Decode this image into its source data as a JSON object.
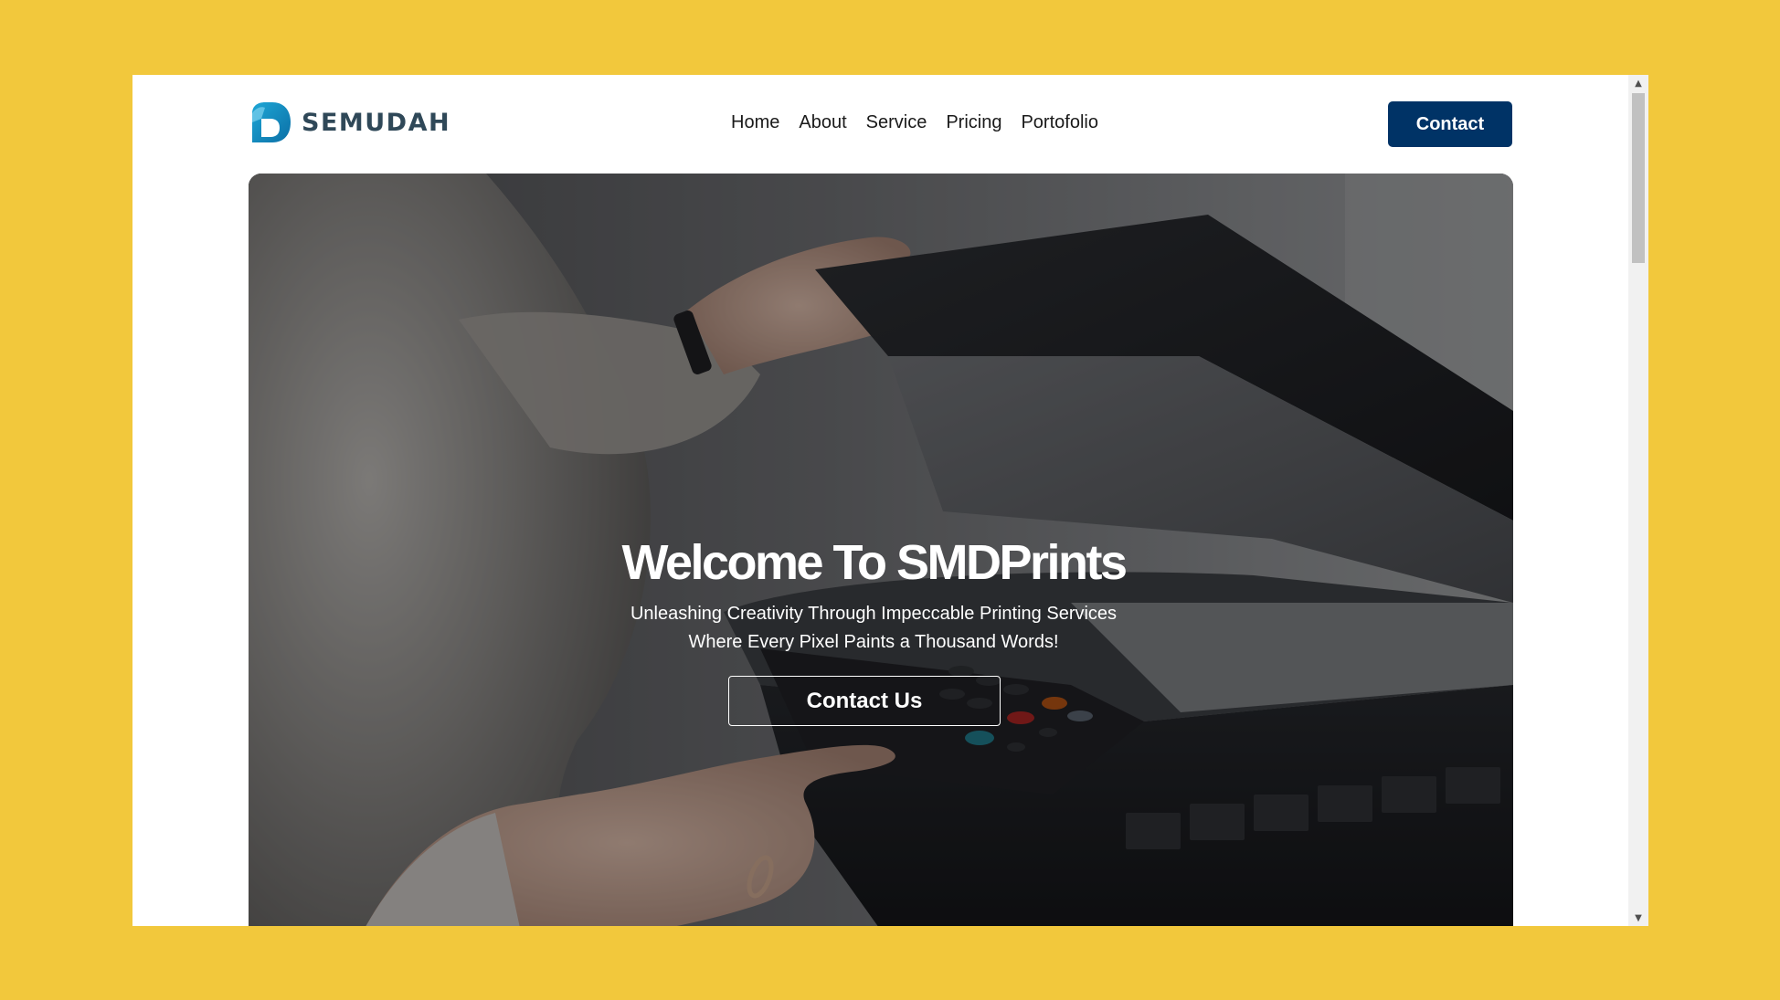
{
  "brand": {
    "name": "SEMUDAH",
    "logo_icon": "semudah-logo-icon",
    "logo_color": "#1B9ACB",
    "text_color": "#2F4858"
  },
  "nav": {
    "items": [
      {
        "label": "Home"
      },
      {
        "label": "About"
      },
      {
        "label": "Service"
      },
      {
        "label": "Pricing"
      },
      {
        "label": "Portofolio"
      }
    ]
  },
  "header": {
    "contact_label": "Contact",
    "contact_color": "#003366"
  },
  "hero": {
    "title": "Welcome To SMDPrints",
    "subtitle_line1": "Unleashing Creativity Through Impeccable Printing Services",
    "subtitle_line2": "Where Every Pixel Paints a Thousand Words!",
    "button_label": "Contact Us"
  },
  "scrollbar": {
    "up_icon": "scroll-up-arrow-icon",
    "down_icon": "scroll-down-arrow-icon"
  },
  "colors": {
    "background": "#F2C83C"
  }
}
